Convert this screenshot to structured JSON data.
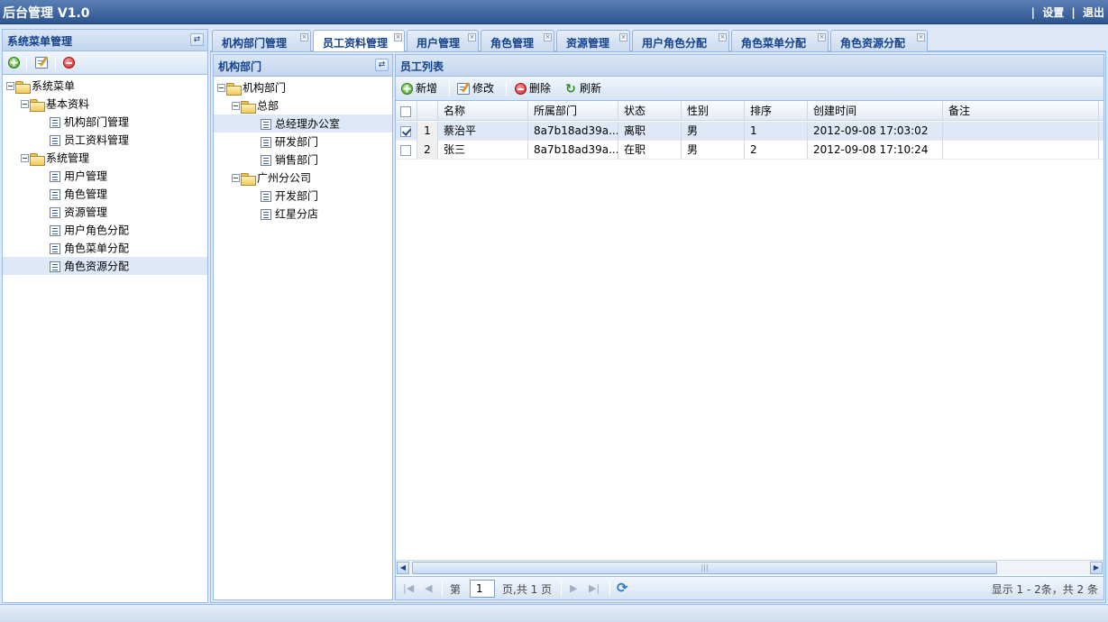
{
  "app": {
    "title": "后台管理 V1.0",
    "links": [
      "设置",
      "退出"
    ]
  },
  "menu_panel": {
    "title": "系统菜单管理",
    "toolbar": [
      "add-icon",
      "edit-icon",
      "delete-icon"
    ],
    "tree": [
      {
        "label": "系统菜单",
        "level": 0,
        "type": "folder"
      },
      {
        "label": "基本资料",
        "level": 1,
        "type": "folder"
      },
      {
        "label": "机构部门管理",
        "level": 2,
        "type": "leaf"
      },
      {
        "label": "员工资料管理",
        "level": 2,
        "type": "leaf"
      },
      {
        "label": "系统管理",
        "level": 1,
        "type": "folder"
      },
      {
        "label": "用户管理",
        "level": 2,
        "type": "leaf"
      },
      {
        "label": "角色管理",
        "level": 2,
        "type": "leaf"
      },
      {
        "label": "资源管理",
        "level": 2,
        "type": "leaf"
      },
      {
        "label": "用户角色分配",
        "level": 2,
        "type": "leaf"
      },
      {
        "label": "角色菜单分配",
        "level": 2,
        "type": "leaf"
      },
      {
        "label": "角色资源分配",
        "level": 2,
        "type": "leaf",
        "selected": true
      }
    ]
  },
  "tabs": [
    {
      "label": "机构部门管理"
    },
    {
      "label": "员工资料管理",
      "active": true
    },
    {
      "label": "用户管理"
    },
    {
      "label": "角色管理"
    },
    {
      "label": "资源管理"
    },
    {
      "label": "用户角色分配"
    },
    {
      "label": "角色菜单分配"
    },
    {
      "label": "角色资源分配"
    }
  ],
  "dept_panel": {
    "title": "机构部门",
    "tree": [
      {
        "label": "机构部门",
        "level": 0,
        "type": "folder"
      },
      {
        "label": "总部",
        "level": 1,
        "type": "folder"
      },
      {
        "label": "总经理办公室",
        "level": 2,
        "type": "leaf",
        "selected": true
      },
      {
        "label": "研发部门",
        "level": 2,
        "type": "leaf"
      },
      {
        "label": "销售部门",
        "level": 2,
        "type": "leaf"
      },
      {
        "label": "广州分公司",
        "level": 1,
        "type": "folder"
      },
      {
        "label": "开发部门",
        "level": 2,
        "type": "leaf"
      },
      {
        "label": "红星分店",
        "level": 2,
        "type": "leaf"
      }
    ]
  },
  "emp_panel": {
    "title": "员工列表",
    "toolbar": {
      "add": "新增",
      "edit": "修改",
      "delete": "删除",
      "refresh": "刷新"
    },
    "columns": [
      "名称",
      "所属部门",
      "状态",
      "性别",
      "排序",
      "创建时间",
      "备注"
    ],
    "rows": [
      {
        "no": "1",
        "checked": true,
        "cells": [
          "蔡治平",
          "8a7b18ad39a...",
          "离职",
          "男",
          "1",
          "2012-09-08 17:03:02",
          ""
        ]
      },
      {
        "no": "2",
        "checked": false,
        "cells": [
          "张三",
          "8a7b18ad39a...",
          "在职",
          "男",
          "2",
          "2012-09-08 17:10:24",
          ""
        ]
      }
    ],
    "pager": {
      "page_label": "第",
      "page_value": "1",
      "pages_label": "页,共 1 页",
      "summary": "显示 1 - 2条，共 2 条"
    }
  }
}
